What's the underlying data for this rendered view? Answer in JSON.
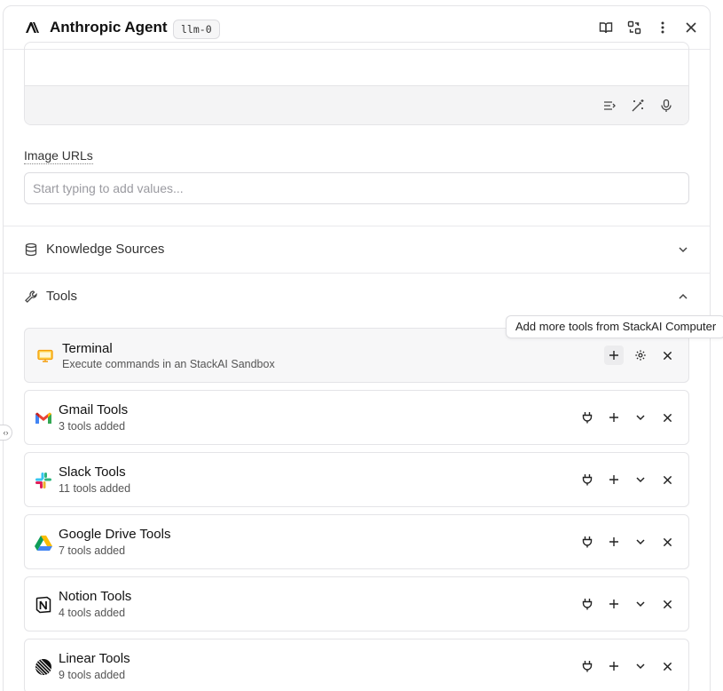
{
  "header": {
    "title": "Anthropic Agent",
    "model_badge": "llm-0",
    "icons": [
      "book-open-icon",
      "swap-icon",
      "more-vertical-icon",
      "close-icon"
    ]
  },
  "prompt": {
    "toolbar_icons": [
      "list-insert-icon",
      "magic-wand-icon",
      "microphone-icon"
    ]
  },
  "image_urls": {
    "label": "Image URLs",
    "placeholder": "Start typing to add values..."
  },
  "sections": {
    "knowledge": {
      "label": "Knowledge Sources",
      "icon": "database-icon"
    },
    "tools": {
      "label": "Tools",
      "icon": "wrench-icon"
    }
  },
  "tooltip": "Add more tools from StackAI Computer",
  "tools": [
    {
      "name": "Terminal",
      "subtitle": "Execute commands in an StackAI Sandbox",
      "icon": "monitor-icon"
    },
    {
      "name": "Gmail Tools",
      "subtitle": "3 tools added",
      "icon": "gmail-icon"
    },
    {
      "name": "Slack Tools",
      "subtitle": "11 tools added",
      "icon": "slack-icon"
    },
    {
      "name": "Google Drive Tools",
      "subtitle": "7 tools added",
      "icon": "google-drive-icon"
    },
    {
      "name": "Notion Tools",
      "subtitle": "4 tools added",
      "icon": "notion-icon"
    },
    {
      "name": "Linear Tools",
      "subtitle": "9 tools added",
      "icon": "linear-icon"
    }
  ],
  "colors": {
    "accent_orange": "#f59e0b",
    "border": "#e4e4e7"
  }
}
